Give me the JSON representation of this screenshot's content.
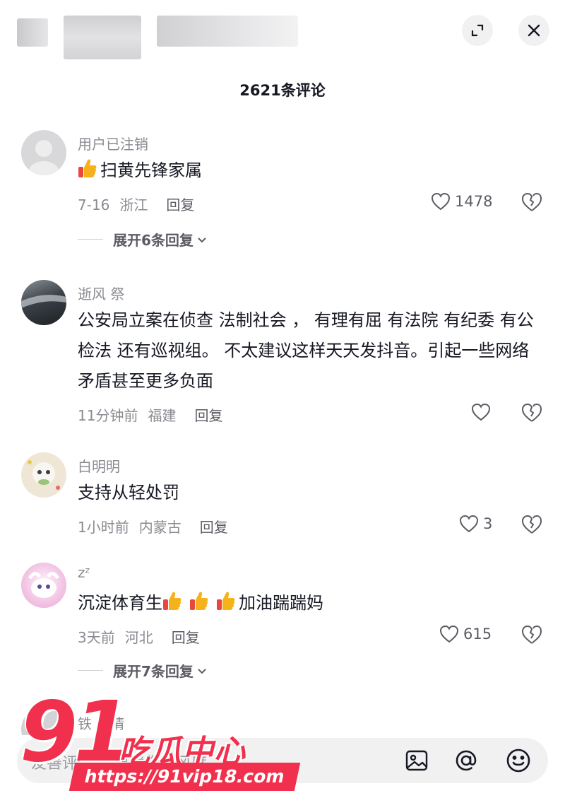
{
  "header": {
    "expand_icon": "expand-icon",
    "close_icon": "close-icon"
  },
  "title": "2621条评论",
  "colors": {
    "text": "#161823",
    "muted": "#8a8b91",
    "watermark": "#f0304c",
    "input_bg": "#f1f1f2"
  },
  "comments": [
    {
      "username": "用户已注销",
      "text": "扫黄先锋家属",
      "leading_emoji": "thumbs-up",
      "date": "7-16",
      "location": "浙江",
      "reply": "回复",
      "likes": "1478",
      "expand": "展开6条回复"
    },
    {
      "username": "逝风 祭",
      "text": "公安局立案在侦查  法制社会 ，  有理有屈  有法院  有纪委  有公检法   还有巡视组。   不太建议这样天天发抖音。引起一些网络矛盾甚至更多负面",
      "date": "11分钟前",
      "location": "福建",
      "reply": "回复",
      "likes": ""
    },
    {
      "username": "白明明",
      "text": "支持从轻处罚",
      "date": "1小时前",
      "location": "内蒙古",
      "reply": "回复",
      "likes": "3"
    },
    {
      "username": "zᶻ",
      "text_before": "沉淀体育生",
      "text_after": "加油踹踹妈",
      "emoji_count": 3,
      "date": "3天前",
      "location": "河北",
      "reply": "回复",
      "likes": "615",
      "expand": "展开7条回复"
    }
  ],
  "partial_comment": {
    "username": "铁 爱情"
  },
  "input": {
    "placeholder": "友善评论，  温暖你的风度",
    "image_icon": "image-icon",
    "mention_icon": "at-mention-icon",
    "emoji_icon": "emoji-icon"
  },
  "watermark": {
    "number": "91",
    "chinese": "吃瓜中心",
    "url": "https://91vip18.com"
  }
}
